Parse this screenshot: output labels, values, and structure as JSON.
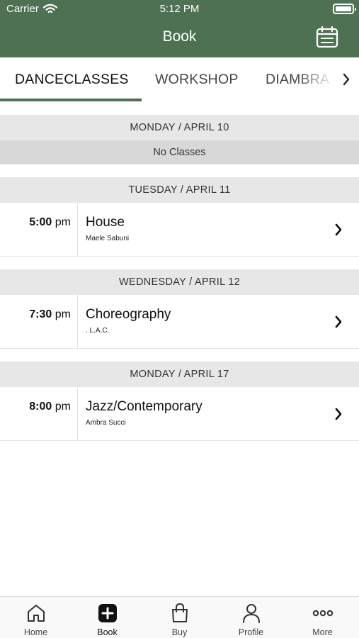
{
  "status_bar": {
    "carrier": "Carrier",
    "time": "5:12 PM"
  },
  "nav": {
    "title": "Book",
    "calendar_icon": "calendar-icon"
  },
  "tabs": [
    {
      "label": "DANCECLASSES",
      "active": true
    },
    {
      "label": "WORKSHOP",
      "active": false
    },
    {
      "label": "DIAMBRA I",
      "active": false
    }
  ],
  "days": [
    {
      "header": "MONDAY / APRIL 10",
      "empty_label": "No Classes",
      "classes": []
    },
    {
      "header": "TUESDAY / APRIL 11",
      "classes": [
        {
          "time": "5:00",
          "period": "pm",
          "name": "House",
          "teacher": "Maele Sabuni"
        }
      ]
    },
    {
      "header": "WEDNESDAY / APRIL 12",
      "classes": [
        {
          "time": "7:30",
          "period": "pm",
          "name": "Choreography",
          "teacher": ". L.A.C."
        }
      ]
    },
    {
      "header": "MONDAY / APRIL 17",
      "classes": [
        {
          "time": "8:00",
          "period": "pm",
          "name": "Jazz/Contemporary",
          "teacher": "Ambra Succi"
        }
      ]
    }
  ],
  "tabbar": [
    {
      "label": "Home",
      "icon": "home-icon"
    },
    {
      "label": "Book",
      "icon": "plus-square-icon",
      "active": true
    },
    {
      "label": "Buy",
      "icon": "shopping-bag-icon"
    },
    {
      "label": "Profile",
      "icon": "person-icon"
    },
    {
      "label": "More",
      "icon": "ellipsis-icon"
    }
  ],
  "colors": {
    "brand": "#4d7152",
    "day_header_bg": "#e7e7e7",
    "no_classes_bg": "#d8d8d8"
  }
}
